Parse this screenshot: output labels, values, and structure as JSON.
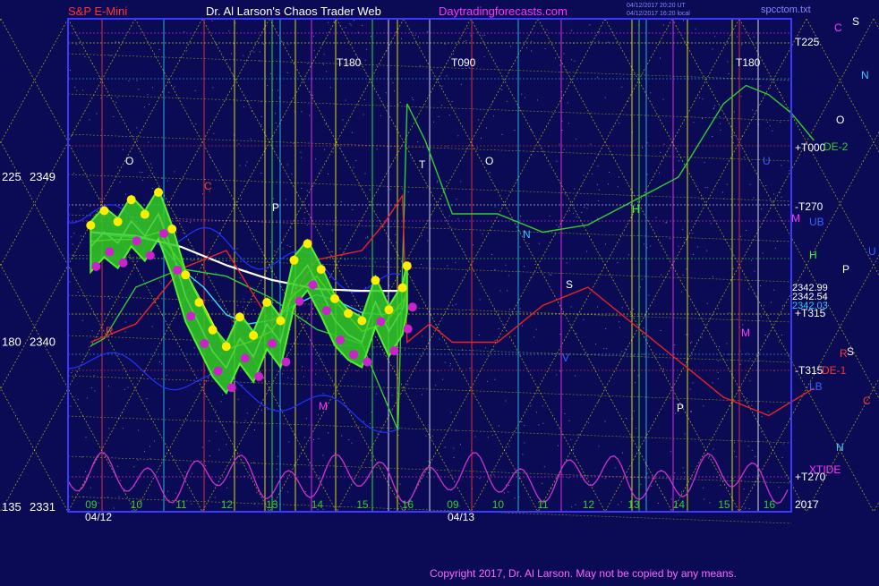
{
  "header": {
    "symbol": "S&P E-Mini",
    "site_title": "Dr. Al Larson's Chaos Trader Web",
    "url": "Daytradingforecasts.com",
    "stamp1": "04/12/2017 20:20 UT",
    "stamp2": "04/12/2017 16:20 local",
    "file": "spcctom.txt"
  },
  "colors": {
    "background": "#0a0a55",
    "frame": "#3a3aff",
    "grid_yellow": "#e8e800",
    "price_white": "#ffffff",
    "ma_cyan": "#33ddff",
    "forecast_green": "#33cc33",
    "red_line": "#ee2222",
    "magenta_line": "#cc33cc",
    "blue_line": "#2233ff",
    "dot_yellow": "#ffee00",
    "dot_magenta": "#cc22cc"
  },
  "chart_data": {
    "type": "line",
    "title": "S&P E-Mini",
    "ylim": [
      2331,
      2353
    ],
    "y_ticks": [
      {
        "label_left": "225",
        "label_right": "2349",
        "value": 2349
      },
      {
        "label_left": "180",
        "label_right": "2340",
        "value": 2340
      },
      {
        "label_left": "135",
        "label_right": "2331",
        "value": 2331
      }
    ],
    "x_hours": [
      "09",
      "10",
      "11",
      "12",
      "13",
      "14",
      "15",
      "16",
      "09",
      "10",
      "11",
      "12",
      "13",
      "14",
      "15",
      "16"
    ],
    "x_dates": [
      "04/12",
      "04/13"
    ],
    "year": "2017",
    "price_labels": [
      "2342.99",
      "2342.54",
      "2342.03"
    ],
    "right_labels": [
      {
        "text": "T225",
        "color": "#ffffff"
      },
      {
        "text": "+T000",
        "color": "#ffffff"
      },
      {
        "text": "-T270",
        "color": "#ffffff"
      },
      {
        "text": "+T315",
        "color": "#ffffff"
      },
      {
        "text": "-T315",
        "color": "#ffffff"
      },
      {
        "text": "+T270",
        "color": "#ffffff"
      },
      {
        "text": "DE-2",
        "color": "#33cc33"
      },
      {
        "text": "DE-1",
        "color": "#ff3333"
      },
      {
        "text": "XTIDE",
        "color": "#ff33ff"
      },
      {
        "text": "M",
        "color": "#ff33ff"
      },
      {
        "text": "UB",
        "color": "#3366ff"
      },
      {
        "text": "LB",
        "color": "#3366ff"
      },
      {
        "text": "H",
        "color": "#33ff33"
      },
      {
        "text": "C",
        "color": "#ff33ff"
      },
      {
        "text": "S",
        "color": "#ffffff"
      },
      {
        "text": "N",
        "color": "#33ccff"
      },
      {
        "text": "O",
        "color": "#ffffff"
      },
      {
        "text": "P",
        "color": "#ffffff"
      },
      {
        "text": "U",
        "color": "#3366ff"
      }
    ],
    "top_labels": [
      "T180",
      "T090",
      "T180"
    ],
    "in_chart_letters": [
      "O",
      "P",
      "M",
      "R",
      "C",
      "N",
      "S",
      "V",
      "U",
      "H",
      "T"
    ],
    "series": [
      {
        "name": "price",
        "color": "#ffffff",
        "x": [
          0,
          0.3,
          0.6,
          0.9,
          1.2,
          1.5,
          1.8,
          2.1,
          2.4,
          2.7,
          3.0,
          3.3,
          3.6,
          3.9,
          4.2,
          4.5,
          4.8,
          5.1,
          5.4,
          5.7,
          6.0,
          6.3,
          6.6,
          6.9,
          7.0
        ],
        "y": [
          2345.2,
          2346.0,
          2345.4,
          2346.6,
          2345.8,
          2347.0,
          2345.0,
          2342.5,
          2341.0,
          2339.5,
          2338.6,
          2340.2,
          2339.2,
          2341.0,
          2340.0,
          2343.3,
          2344.2,
          2342.8,
          2341.2,
          2340.4,
          2340.0,
          2342.2,
          2340.6,
          2341.8,
          2342.99
        ]
      },
      {
        "name": "ma-fast",
        "color": "#ffff00",
        "x": [
          0,
          0.5,
          1.0,
          1.5,
          2.0,
          2.5,
          3.0,
          3.5,
          4.0,
          4.5,
          5.0,
          5.5,
          6.0,
          6.5,
          7.0
        ],
        "y": [
          2345.5,
          2345.6,
          2345.6,
          2346.0,
          2344.3,
          2342.0,
          2339.6,
          2340.0,
          2340.6,
          2342.6,
          2343.6,
          2342.0,
          2340.6,
          2341.0,
          2342.54
        ]
      },
      {
        "name": "ma-mid",
        "color": "#33ddff",
        "x": [
          0,
          0.5,
          1.0,
          1.5,
          2.0,
          2.5,
          3.0,
          3.5,
          4.0,
          4.5,
          5.0,
          5.5,
          6.0,
          6.5,
          7.0
        ],
        "y": [
          2346.0,
          2345.8,
          2345.7,
          2345.5,
          2344.0,
          2343.0,
          2341.5,
          2341.0,
          2341.2,
          2342.0,
          2342.6,
          2342.2,
          2341.6,
          2341.5,
          2342.03
        ]
      },
      {
        "name": "ma-slow",
        "color": "#ffffff",
        "x": [
          0,
          1,
          2,
          3,
          4,
          5,
          6,
          7
        ],
        "y": [
          2346.0,
          2345.8,
          2345.2,
          2344.2,
          2343.4,
          2342.9,
          2342.8,
          2342.8
        ]
      },
      {
        "name": "DE-2",
        "color": "#33cc33",
        "x": [
          0,
          0.3,
          1,
          2,
          3,
          4,
          5,
          6,
          6.8,
          7.0,
          7.4,
          8,
          9,
          10,
          11,
          12,
          13,
          14,
          14.5,
          15,
          15.5,
          16
        ],
        "y": [
          2339.8,
          2340.2,
          2343,
          2344,
          2343.6,
          2342.4,
          2340.7,
          2339.9,
          2335.2,
          2353,
          2351,
          2347,
          2347,
          2346,
          2346.4,
          2347.7,
          2349,
          2353,
          2354,
          2353.5,
          2352.5,
          2351
        ]
      },
      {
        "name": "DE-1",
        "color": "#ee2222",
        "x": [
          0,
          1,
          2,
          3,
          4,
          5,
          6,
          6.5,
          6.9,
          7.0,
          7.5,
          8,
          9,
          10,
          11,
          12,
          13,
          14,
          15,
          16
        ],
        "y": [
          2340,
          2341,
          2344,
          2345,
          2341,
          2344.5,
          2345,
          2346.5,
          2348,
          2340,
          2341,
          2340,
          2340,
          2342,
          2343,
          2341,
          2339,
          2337,
          2336,
          2337.5
        ]
      }
    ]
  },
  "copyright": "Copyright 2017, Dr. Al Larson. May not be copied by any means."
}
